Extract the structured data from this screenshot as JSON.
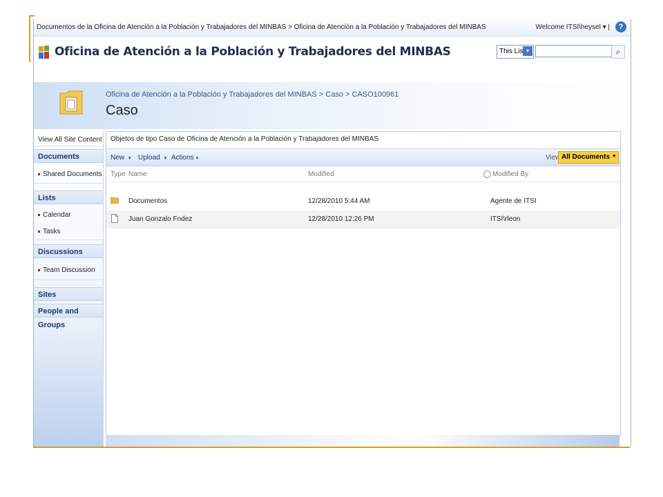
{
  "global_breadcrumb": "Documentos de la Oficina de Atención a la Población y Trabajadores del MINBAS > Oficina de Atención a la Población y Trabajadores del MINBAS",
  "welcome": "Welcome ITSI\\heysel ▾  |",
  "help": "?",
  "site_title": "Oficina de Atención a la Población y Trabajadores del MINBAS",
  "search": {
    "scope": "This List",
    "scope_arrow": "▾",
    "value": "",
    "button": "⌕"
  },
  "page": {
    "breadcrumb": "Oficina de Atención a la Población y Trabajadores del MINBAS > Caso > CASO100961",
    "title": "Caso"
  },
  "nav": {
    "view_all": "View All Site Content",
    "documents_head": "Documents",
    "documents_items": [
      "Shared Documents"
    ],
    "lists_head": "Lists",
    "lists_items": [
      "Calendar",
      "Tasks"
    ],
    "discussions_head": "Discussions",
    "discussions_items": [
      "Team Discussion"
    ],
    "sites_head": "Sites",
    "people_head": "People and Groups"
  },
  "list": {
    "description": "Objetos de tipo Caso de Oficina de Atención a la Población y Trabajadores del MINBAS",
    "toolbar": {
      "new": "New",
      "upload": "Upload",
      "actions": "Actions",
      "arrow": "▾"
    },
    "view_label": "View:",
    "view_value": "All Documents",
    "columns": {
      "type": "Type",
      "name": "Name",
      "modified": "Modified",
      "modified_by": "Modified By"
    },
    "rows": [
      {
        "type": "folder",
        "name": "Documentos",
        "modified": "12/28/2010 5:44 AM",
        "modified_by": "Agente de ITSI"
      },
      {
        "type": "document",
        "name": "Juan Gonzalo Fndez",
        "modified": "12/28/2010 12:26 PM",
        "modified_by": "ITSI\\rleon"
      }
    ]
  },
  "colors": {
    "accent_gold": "#c9a227",
    "nav_blue": "#1b3a6a",
    "view_highlight": "#f7d04a"
  }
}
